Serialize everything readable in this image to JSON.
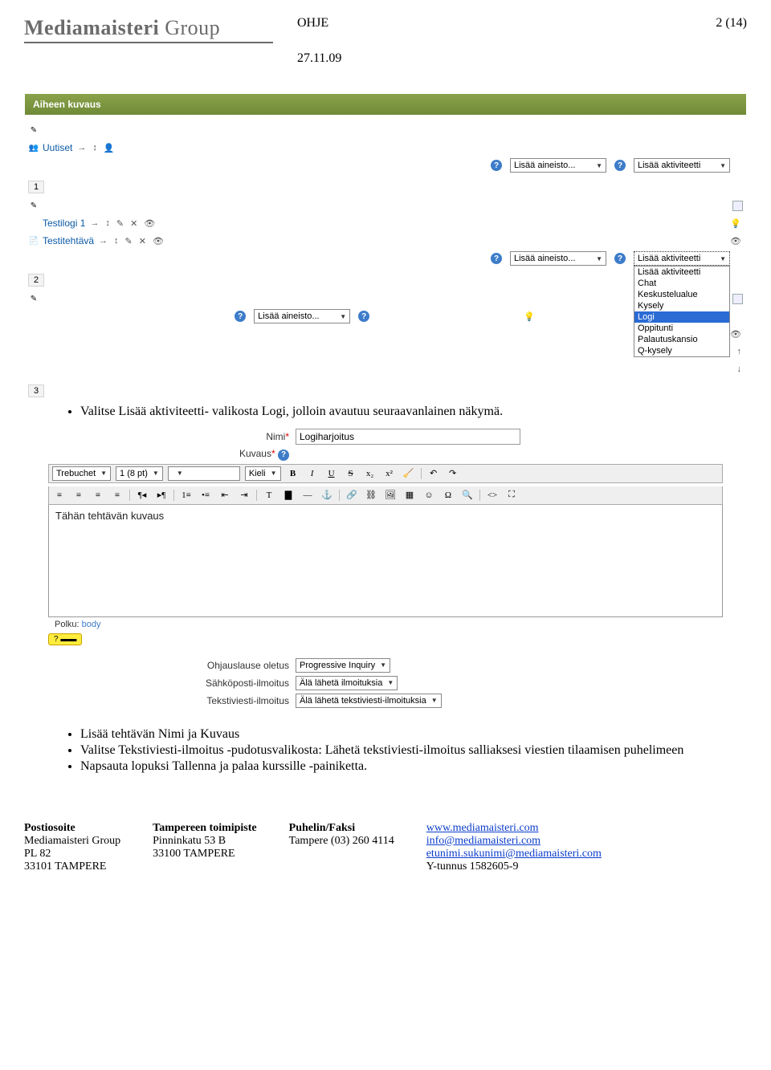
{
  "doc": {
    "logo_main": "Mediamaisteri",
    "logo_sub": "Group",
    "title": "OHJE",
    "date": "27.11.09",
    "page": "2 (14)"
  },
  "s1": {
    "title": "Aiheen kuvaus",
    "uutiset": "Uutiset",
    "add_resource": "Lisää aineisto...",
    "add_activity": "Lisää aktiviteetti",
    "sec1": "1",
    "sec2": "2",
    "sec3": "3",
    "testilogi": "Testilogi 1",
    "testitehtava": "Testitehtävä",
    "dd": {
      "o0": "Lisää aktiviteetti",
      "o1": "Chat",
      "o2": "Keskustelualue",
      "o3": "Kysely",
      "o4": "Logi",
      "o5": "Oppitunti",
      "o6": "Palautuskansio",
      "o7": "Q-kysely"
    }
  },
  "b1": "Valitse Lisää aktiviteetti- valikosta Logi, jolloin avautuu seuraavanlainen näkymä.",
  "s2": {
    "name_label": "Nimi",
    "name_value": "Logiharjoitus",
    "desc_label": "Kuvaus",
    "font": "Trebuchet",
    "size": "1 (8 pt)",
    "lang": "Kieli",
    "editor_text": "Tähän tehtävän kuvaus",
    "path_label": "Polku:",
    "path_value": "body",
    "ohjaus_label": "Ohjauslause oletus",
    "ohjaus_value": "Progressive Inquiry",
    "email_label": "Sähköposti-ilmoitus",
    "email_value": "Älä lähetä ilmoituksia",
    "sms_label": "Tekstiviesti-ilmoitus",
    "sms_value": "Älä lähetä tekstiviesti-ilmoituksia"
  },
  "b2a": "Lisää tehtävän Nimi ja Kuvaus",
  "b2b": "Valitse Tekstiviesti-ilmoitus -pudotusvalikosta: Lähetä tekstiviesti-ilmoitus salliaksesi viestien tilaamisen puhelimeen",
  "b2c": "Napsauta lopuksi Tallenna ja palaa kurssille -painiketta.",
  "footer": {
    "c1h": "Postiosoite",
    "c1a": "Mediamaisteri Group",
    "c1b": "PL 82",
    "c1c": "33101 TAMPERE",
    "c2h": "Tampereen toimipiste",
    "c2a": "Pinninkatu  53 B",
    "c2b": "33100 TAMPERE",
    "c3h": "Puhelin/Faksi",
    "c3a": "Tampere (03) 260 4114",
    "c4a": "www.mediamaisteri.com",
    "c4b": "info@mediamaisteri.com",
    "c4c": "etunimi.sukunimi@mediamaisteri.com",
    "c4d": "Y-tunnus 1582605-9"
  }
}
